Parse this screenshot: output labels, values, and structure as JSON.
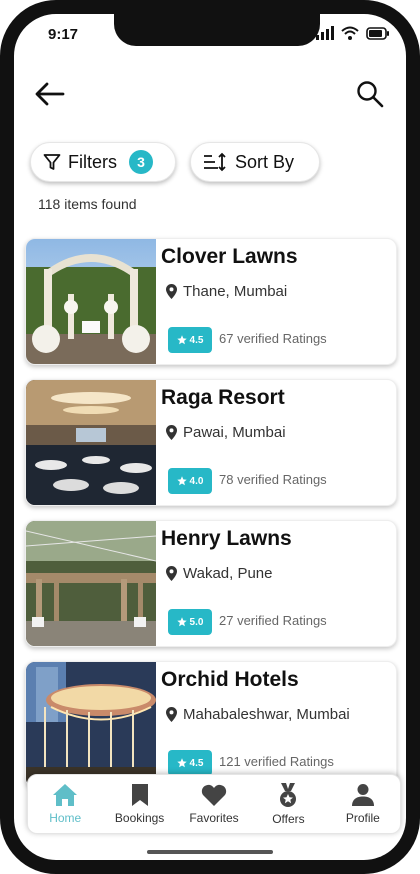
{
  "status": {
    "time": "9:17"
  },
  "filters": {
    "label": "Filters",
    "count": "3"
  },
  "sort": {
    "label": "Sort By"
  },
  "results": {
    "count_text": "118 items found"
  },
  "venues": [
    {
      "name": "Clover Lawns",
      "location": "Thane, Mumbai",
      "rating": "4.5",
      "ratings_text": "67 verified Ratings"
    },
    {
      "name": "Raga Resort",
      "location": "Pawai, Mumbai",
      "rating": "4.0",
      "ratings_text": "78 verified Ratings"
    },
    {
      "name": "Henry Lawns",
      "location": "Wakad, Pune",
      "rating": "5.0",
      "ratings_text": "27 verified Ratings"
    },
    {
      "name": "Orchid Hotels",
      "location": "Mahabaleshwar, Mumbai",
      "rating": "4.5",
      "ratings_text": "121 verified Ratings"
    }
  ],
  "nav": [
    {
      "label": "Home",
      "icon": "home-icon",
      "active": true
    },
    {
      "label": "Bookings",
      "icon": "bookmark-icon",
      "active": false
    },
    {
      "label": "Favorites",
      "icon": "heart-icon",
      "active": false
    },
    {
      "label": "Offers",
      "icon": "medal-icon",
      "active": false
    },
    {
      "label": "Profile",
      "icon": "user-icon",
      "active": false
    }
  ],
  "colors": {
    "accent": "#27b8c7",
    "active_nav": "#5fbec8"
  }
}
